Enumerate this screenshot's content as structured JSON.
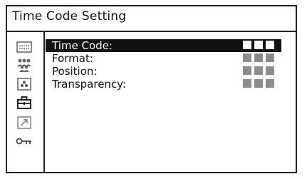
{
  "window": {
    "title": "Time Code Setting"
  },
  "sidebar": {
    "icons": [
      {
        "name": "keypad-icon"
      },
      {
        "name": "people-group-icon"
      },
      {
        "name": "camera-dots-icon"
      },
      {
        "name": "briefcase-icon"
      },
      {
        "name": "arrow-box-icon"
      },
      {
        "name": "key-icon"
      }
    ]
  },
  "menu": {
    "items": [
      {
        "label": "Time Code:",
        "value_blocks": 3,
        "selected": true
      },
      {
        "label": "Format:",
        "value_blocks": 3,
        "selected": false
      },
      {
        "label": "Position:",
        "value_blocks": 3,
        "selected": false
      },
      {
        "label": "Transparency:",
        "value_blocks": 3,
        "selected": false
      }
    ]
  },
  "colors": {
    "selected_background": "#111111",
    "selected_text": "#ffffff",
    "value_block": "#8c8c8c",
    "frame": "#222222"
  }
}
